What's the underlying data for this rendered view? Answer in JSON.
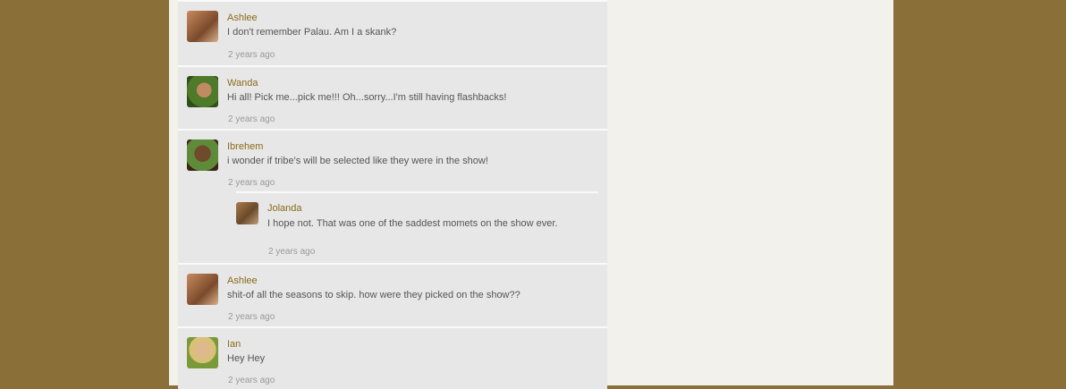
{
  "comments": [
    {
      "author": "Ashlee",
      "text": "I don't remember Palau.  Am I a skank?",
      "time": "2 years ago",
      "avatar": "ashlee-avatar",
      "avatar_colors": [
        "#c98a5e",
        "#7a4a2c",
        "#d9b08a"
      ]
    },
    {
      "author": "Wanda",
      "text": "Hi all!  Pick me...pick me!!!  Oh...sorry...I'm still having flashbacks!",
      "time": "2 years ago",
      "avatar": "wanda-avatar",
      "avatar_colors": [
        "#4e7a2a",
        "#c08a62",
        "#2f4f1a"
      ]
    },
    {
      "author": "Ibrehem",
      "text": "i wonder if tribe's will be selected like they were in the show!",
      "time": "2 years ago",
      "avatar": "ibrehem-avatar",
      "avatar_colors": [
        "#6f4a2b",
        "#5f8a3a",
        "#3a2414"
      ],
      "reply": {
        "author": "Jolanda",
        "text": "I hope not. That was one of the saddest momets on the show ever.",
        "time": "2 years ago",
        "avatar": "jolanda-avatar",
        "avatar_colors": [
          "#a87a4a",
          "#6a4a2a",
          "#c0a07a"
        ]
      }
    },
    {
      "author": "Ashlee",
      "text": "shit-of all the seasons to skip.  how were they picked on the show??",
      "time": "2 years ago",
      "avatar": "ashlee-avatar",
      "avatar_colors": [
        "#c98a5e",
        "#7a4a2c",
        "#d9b08a"
      ]
    },
    {
      "author": "Ian",
      "text": "Hey Hey",
      "time": "2 years ago",
      "avatar": "ian-avatar",
      "avatar_colors": [
        "#d9c07a",
        "#7a9a3a",
        "#e0b890"
      ]
    }
  ]
}
